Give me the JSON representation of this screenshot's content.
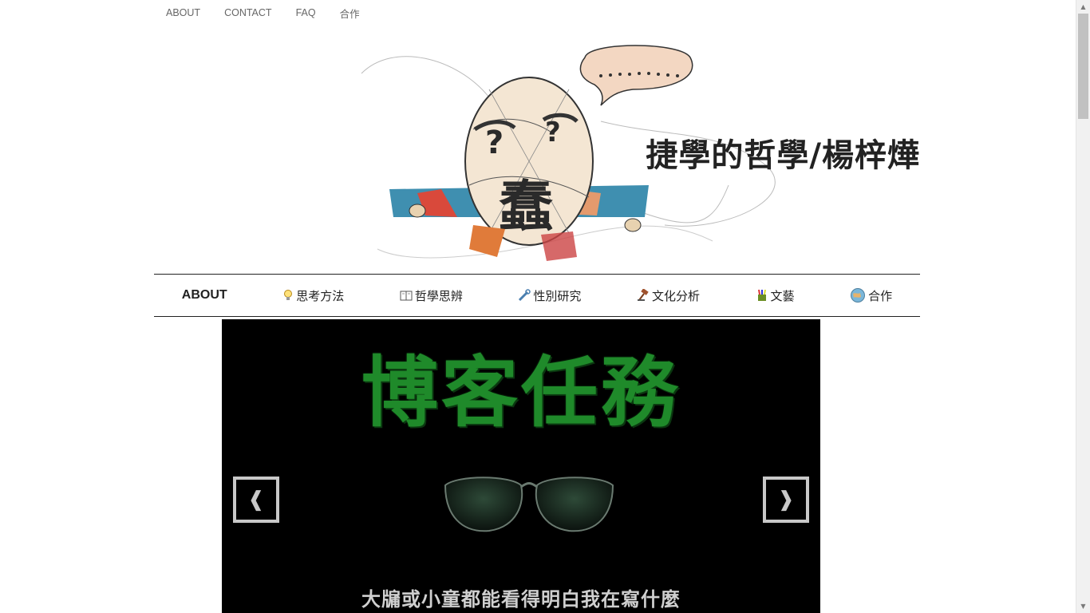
{
  "topnav": {
    "items": [
      "ABOUT",
      "CONTACT",
      "FAQ",
      "合作"
    ]
  },
  "header": {
    "site_title": "捷學的哲學/楊梓燁",
    "logo_glyph": "蠢"
  },
  "mainnav": {
    "items": [
      {
        "label": "ABOUT",
        "icon": "none"
      },
      {
        "label": "思考方法",
        "icon": "lightbulb-icon"
      },
      {
        "label": "哲學思辨",
        "icon": "book-icon"
      },
      {
        "label": "性別研究",
        "icon": "wrench-icon"
      },
      {
        "label": "文化分析",
        "icon": "gavel-icon"
      },
      {
        "label": "文藝",
        "icon": "art-supplies-icon"
      },
      {
        "label": "合作",
        "icon": "globe-icon"
      }
    ]
  },
  "slider": {
    "title": "博客任務",
    "caption": "大牖或小童都能看得明白我在寫什麼",
    "prev_label": "❰",
    "next_label": "❱"
  },
  "colors": {
    "matrix_green": "#1f8a2a",
    "slider_bg": "#000000",
    "nav_border": "#222222"
  }
}
